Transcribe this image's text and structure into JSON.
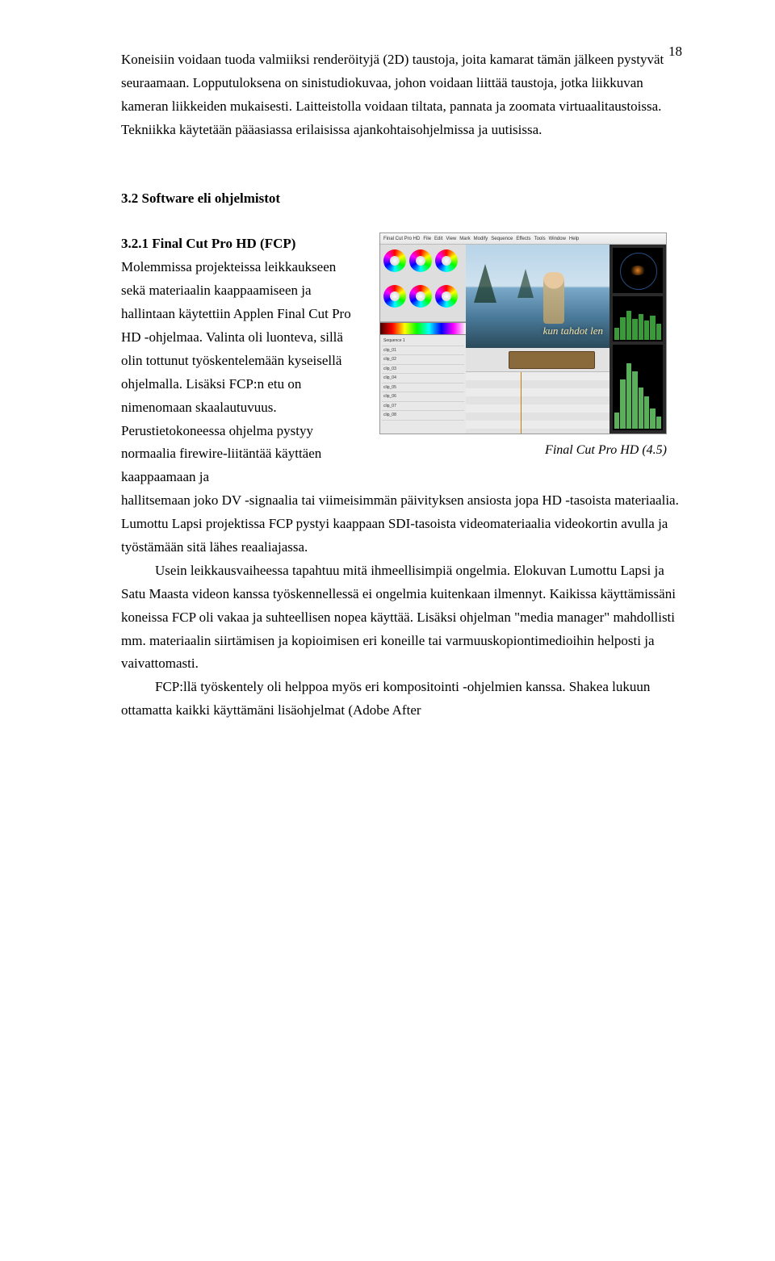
{
  "page": {
    "number": "18"
  },
  "intro": {
    "p1": "Koneisiin voidaan tuoda valmiiksi renderöityjä (2D) taustoja, joita kamarat tämän jälkeen pystyvät seuraamaan. Lopputuloksena on sinistudiokuvaa, johon voidaan liittää taustoja, jotka liikkuvan kameran liikkeiden mukaisesti. Laitteistolla voidaan tiltata, pannata ja zoomata virtuaalitaustoissa. Tekniikka käytetään pääasiassa erilaisissa ajankohtaisohjelmissa ja uutisissa."
  },
  "section": {
    "heading": "3.2 Software eli ohjelmistot"
  },
  "subsection": {
    "title": "3.2.1 Final Cut Pro HD (FCP)",
    "left_text": "Molemmissa projekteissa leikkaukseen sekä materiaalin kaappaamiseen ja hallintaan käytettiin Applen Final Cut Pro HD -ohjelmaa. Valinta oli luonteva, sillä olin tottunut työskentelemään kyseisellä ohjelmalla. Lisäksi FCP:n etu on nimenomaan skaalautuvuus. Perustietokoneessa ohjelma pystyy normaalia firewire-liitäntää käyttäen kaappaamaan ja",
    "caption": "Final Cut Pro HD (4.5)"
  },
  "fcp_ui": {
    "menubar": [
      "Final Cut Pro HD",
      "File",
      "Edit",
      "View",
      "Mark",
      "Modify",
      "Sequence",
      "Effects",
      "Tools",
      "Window",
      "Help"
    ],
    "overlay": "kun tahdot len",
    "browser_rows": [
      "Sequence 1",
      "clip_01",
      "clip_02",
      "clip_03",
      "clip_04",
      "clip_05",
      "clip_06",
      "clip_07",
      "clip_08"
    ]
  },
  "continuation": {
    "p1": "hallitsemaan joko DV -signaalia tai viimeisimmän päivityksen ansiosta jopa HD -tasoista materiaalia. Lumottu Lapsi projektissa FCP pystyi kaappaan SDI-tasoista videomateriaalia videokortin avulla ja työstämään sitä lähes reaaliajassa.",
    "p2": "Usein leikkausvaiheessa tapahtuu mitä ihmeellisimpiä ongelmia. Elokuvan Lumottu Lapsi ja Satu Maasta videon kanssa työskennellessä ei ongelmia kuitenkaan ilmennyt. Kaikissa käyttämissäni koneissa FCP oli vakaa ja suhteellisen nopea käyttää. Lisäksi ohjelman \"media manager\" mahdollisti mm. materiaalin siirtämisen ja kopioimisen  eri koneille tai varmuuskopiontimedioihin helposti ja vaivattomasti.",
    "p3": "FCP:llä työskentely oli helppoa myös eri kompositointi -ohjelmien kanssa. Shakea lukuun ottamatta kaikki käyttämäni lisäohjelmat (Adobe After"
  }
}
